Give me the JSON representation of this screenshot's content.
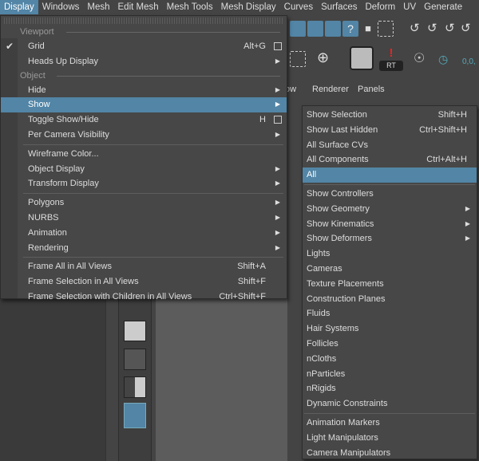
{
  "menubar": [
    "Display",
    "Windows",
    "Mesh",
    "Edit Mesh",
    "Mesh Tools",
    "Mesh Display",
    "Curves",
    "Surfaces",
    "Deform",
    "UV",
    "Generate"
  ],
  "panel_menu": [
    "ow",
    "Renderer",
    "Panels"
  ],
  "shelf": {
    "rt_label": "RT",
    "coord_label": "0,0,"
  },
  "colors": {
    "highlight": "#5285a6",
    "menu_bg": "#474747",
    "text": "#dddddd"
  },
  "display_menu": [
    {
      "type": "header",
      "label": "Viewport"
    },
    {
      "type": "item",
      "label": "Grid",
      "shortcut": "Alt+G",
      "checked": true,
      "checkbox": true
    },
    {
      "type": "item",
      "label": "Heads Up Display",
      "submenu": true
    },
    {
      "type": "header",
      "label": "Object"
    },
    {
      "type": "item",
      "label": "Hide",
      "submenu": true
    },
    {
      "type": "item",
      "label": "Show",
      "submenu": true,
      "highlighted": true
    },
    {
      "type": "item",
      "label": "Toggle Show/Hide",
      "shortcut": "H",
      "checkbox": true
    },
    {
      "type": "item",
      "label": "Per Camera Visibility",
      "submenu": true
    },
    {
      "type": "sep"
    },
    {
      "type": "item",
      "label": "Wireframe Color..."
    },
    {
      "type": "item",
      "label": "Object Display",
      "submenu": true
    },
    {
      "type": "item",
      "label": "Transform Display",
      "submenu": true
    },
    {
      "type": "sep"
    },
    {
      "type": "item",
      "label": "Polygons",
      "submenu": true
    },
    {
      "type": "item",
      "label": "NURBS",
      "submenu": true
    },
    {
      "type": "item",
      "label": "Animation",
      "submenu": true
    },
    {
      "type": "item",
      "label": "Rendering",
      "submenu": true
    },
    {
      "type": "sep"
    },
    {
      "type": "item",
      "label": "Frame All in All Views",
      "shortcut": "Shift+A"
    },
    {
      "type": "item",
      "label": "Frame Selection in All Views",
      "shortcut": "Shift+F"
    },
    {
      "type": "item",
      "label": "Frame Selection with Children in All Views",
      "shortcut": "Ctrl+Shift+F"
    }
  ],
  "show_submenu": [
    {
      "type": "item",
      "label": "Show Selection",
      "shortcut": "Shift+H"
    },
    {
      "type": "item",
      "label": "Show Last Hidden",
      "shortcut": "Ctrl+Shift+H"
    },
    {
      "type": "item",
      "label": "All Surface CVs"
    },
    {
      "type": "item",
      "label": "All Components",
      "shortcut": "Ctrl+Alt+H"
    },
    {
      "type": "item",
      "label": "All",
      "highlighted": true
    },
    {
      "type": "sep"
    },
    {
      "type": "item",
      "label": "Show Controllers"
    },
    {
      "type": "item",
      "label": "Show Geometry",
      "submenu": true
    },
    {
      "type": "item",
      "label": "Show Kinematics",
      "submenu": true
    },
    {
      "type": "item",
      "label": "Show Deformers",
      "submenu": true
    },
    {
      "type": "item",
      "label": "Lights"
    },
    {
      "type": "item",
      "label": "Cameras"
    },
    {
      "type": "item",
      "label": "Texture Placements"
    },
    {
      "type": "item",
      "label": "Construction Planes"
    },
    {
      "type": "item",
      "label": "Fluids"
    },
    {
      "type": "item",
      "label": "Hair Systems"
    },
    {
      "type": "item",
      "label": "Follicles"
    },
    {
      "type": "item",
      "label": "nCloths"
    },
    {
      "type": "item",
      "label": "nParticles"
    },
    {
      "type": "item",
      "label": "nRigids"
    },
    {
      "type": "item",
      "label": "Dynamic Constraints"
    },
    {
      "type": "sep"
    },
    {
      "type": "item",
      "label": "Animation Markers"
    },
    {
      "type": "item",
      "label": "Light Manipulators"
    },
    {
      "type": "item",
      "label": "Camera Manipulators"
    }
  ]
}
